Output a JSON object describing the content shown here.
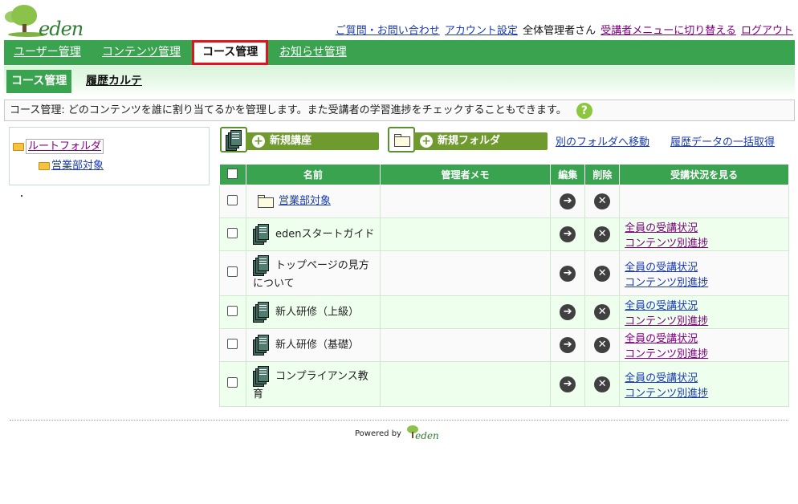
{
  "header": {
    "logo_text": "eden",
    "links": {
      "contact": "ご質問・お問い合わせ",
      "account": "アカウント設定",
      "user_name": "全体管理者さん",
      "switch_menu": "受講者メニューに切り替える",
      "logout": "ログアウト"
    }
  },
  "main_nav": {
    "tabs": [
      {
        "label": "ユーザー管理"
      },
      {
        "label": "コンテンツ管理"
      },
      {
        "label": "コース管理",
        "active": true
      },
      {
        "label": "お知らせ管理"
      }
    ]
  },
  "sub_nav": {
    "tabs": [
      {
        "label": "コース管理",
        "active": true
      },
      {
        "label": "履歴カルテ"
      }
    ]
  },
  "description": "コース管理: どのコンテンツを誰に割り当てるかを管理します。また受講者の学習進捗をチェックすることもできます。",
  "help_icon": "?",
  "folder_tree": {
    "root": "ルートフォルダ",
    "children": [
      "営業部対象"
    ]
  },
  "tree_bullet": "・",
  "toolbar": {
    "new_course": "新規講座",
    "new_folder": "新規フォルダ",
    "move_folder": "別のフォルダへ移動",
    "bulk_history": "履歴データの一括取得"
  },
  "table": {
    "headers": {
      "name": "名前",
      "memo": "管理者メモ",
      "edit": "編集",
      "delete": "削除",
      "status": "受講状況を見る"
    },
    "rows": [
      {
        "type": "folder",
        "name": "営業部対象",
        "memo": "",
        "all_status": "",
        "content_progress": ""
      },
      {
        "type": "course",
        "name": "edenスタートガイド",
        "memo": "",
        "all_status": "全員の受講状況",
        "content_progress": "コンテンツ別進捗"
      },
      {
        "type": "course",
        "name": "トップページの見方について",
        "memo": "",
        "all_status": "全員の受講状況",
        "content_progress": "コンテンツ別進捗"
      },
      {
        "type": "course",
        "name": "新人研修（上級）",
        "memo": "",
        "all_status": "全員の受講状況",
        "content_progress": "コンテンツ別進捗"
      },
      {
        "type": "course",
        "name": "新人研修（基礎）",
        "memo": "",
        "all_status": "全員の受講状況",
        "content_progress": "コンテンツ別進捗"
      },
      {
        "type": "course",
        "name": "コンプライアンス教育",
        "memo": "",
        "all_status": "全員の受講状況",
        "content_progress": "コンテンツ別進捗"
      }
    ]
  },
  "footer": {
    "powered_by": "Powered by",
    "logo_text": "eden"
  },
  "colors": {
    "brand_green": "#3aa34f",
    "button_green": "#6f9a2e",
    "active_tab_border": "#e0141e"
  }
}
